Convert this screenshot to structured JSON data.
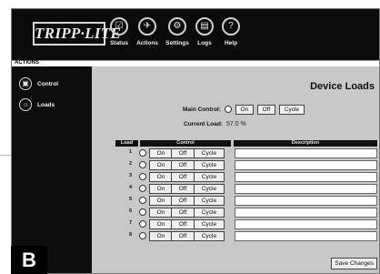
{
  "brand": {
    "logo_text": "TRIPP·LITE"
  },
  "nav": [
    {
      "label": "Status",
      "icon": "status-icon"
    },
    {
      "label": "Actions",
      "icon": "actions-icon"
    },
    {
      "label": "Settings",
      "icon": "settings-icon"
    },
    {
      "label": "Logs",
      "icon": "logs-icon"
    },
    {
      "label": "Help",
      "icon": "help-icon"
    }
  ],
  "section": {
    "title": "ACTIONS"
  },
  "sidebar": [
    {
      "label": "Control",
      "icon": "control-icon"
    },
    {
      "label": "Loads",
      "icon": "loads-icon"
    }
  ],
  "page": {
    "title": "Device Loads",
    "main_control_label": "Main Control:",
    "current_load_label": "Current Load:",
    "current_load_value": "57.0 %"
  },
  "buttons": {
    "on": "On",
    "off": "Off",
    "cycle": "Cycle",
    "save": "Save Changes"
  },
  "table": {
    "headers": {
      "load": "Load",
      "control": "Control",
      "description": "Description"
    },
    "rows": [
      {
        "load": "1",
        "description": ""
      },
      {
        "load": "2",
        "description": ""
      },
      {
        "load": "3",
        "description": ""
      },
      {
        "load": "4",
        "description": ""
      },
      {
        "load": "5",
        "description": ""
      },
      {
        "load": "6",
        "description": ""
      },
      {
        "load": "7",
        "description": ""
      },
      {
        "load": "8",
        "description": ""
      }
    ]
  },
  "figure_label": "B"
}
